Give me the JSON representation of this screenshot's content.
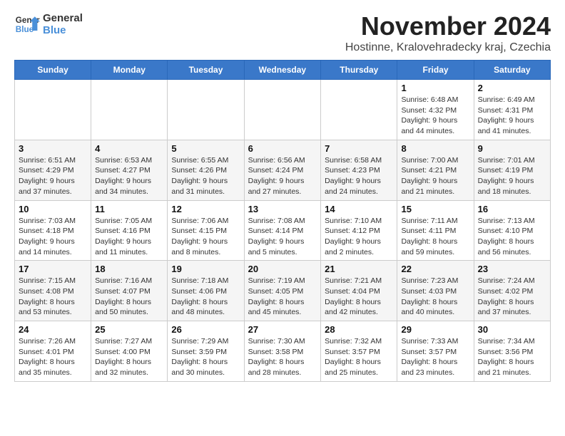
{
  "logo": {
    "line1": "General",
    "line2": "Blue"
  },
  "title": {
    "month": "November 2024",
    "location": "Hostinne, Kralovehradecky kraj, Czechia"
  },
  "weekdays": [
    "Sunday",
    "Monday",
    "Tuesday",
    "Wednesday",
    "Thursday",
    "Friday",
    "Saturday"
  ],
  "weeks": [
    [
      {
        "day": "",
        "info": ""
      },
      {
        "day": "",
        "info": ""
      },
      {
        "day": "",
        "info": ""
      },
      {
        "day": "",
        "info": ""
      },
      {
        "day": "",
        "info": ""
      },
      {
        "day": "1",
        "info": "Sunrise: 6:48 AM\nSunset: 4:32 PM\nDaylight: 9 hours and 44 minutes."
      },
      {
        "day": "2",
        "info": "Sunrise: 6:49 AM\nSunset: 4:31 PM\nDaylight: 9 hours and 41 minutes."
      }
    ],
    [
      {
        "day": "3",
        "info": "Sunrise: 6:51 AM\nSunset: 4:29 PM\nDaylight: 9 hours and 37 minutes."
      },
      {
        "day": "4",
        "info": "Sunrise: 6:53 AM\nSunset: 4:27 PM\nDaylight: 9 hours and 34 minutes."
      },
      {
        "day": "5",
        "info": "Sunrise: 6:55 AM\nSunset: 4:26 PM\nDaylight: 9 hours and 31 minutes."
      },
      {
        "day": "6",
        "info": "Sunrise: 6:56 AM\nSunset: 4:24 PM\nDaylight: 9 hours and 27 minutes."
      },
      {
        "day": "7",
        "info": "Sunrise: 6:58 AM\nSunset: 4:23 PM\nDaylight: 9 hours and 24 minutes."
      },
      {
        "day": "8",
        "info": "Sunrise: 7:00 AM\nSunset: 4:21 PM\nDaylight: 9 hours and 21 minutes."
      },
      {
        "day": "9",
        "info": "Sunrise: 7:01 AM\nSunset: 4:19 PM\nDaylight: 9 hours and 18 minutes."
      }
    ],
    [
      {
        "day": "10",
        "info": "Sunrise: 7:03 AM\nSunset: 4:18 PM\nDaylight: 9 hours and 14 minutes."
      },
      {
        "day": "11",
        "info": "Sunrise: 7:05 AM\nSunset: 4:16 PM\nDaylight: 9 hours and 11 minutes."
      },
      {
        "day": "12",
        "info": "Sunrise: 7:06 AM\nSunset: 4:15 PM\nDaylight: 9 hours and 8 minutes."
      },
      {
        "day": "13",
        "info": "Sunrise: 7:08 AM\nSunset: 4:14 PM\nDaylight: 9 hours and 5 minutes."
      },
      {
        "day": "14",
        "info": "Sunrise: 7:10 AM\nSunset: 4:12 PM\nDaylight: 9 hours and 2 minutes."
      },
      {
        "day": "15",
        "info": "Sunrise: 7:11 AM\nSunset: 4:11 PM\nDaylight: 8 hours and 59 minutes."
      },
      {
        "day": "16",
        "info": "Sunrise: 7:13 AM\nSunset: 4:10 PM\nDaylight: 8 hours and 56 minutes."
      }
    ],
    [
      {
        "day": "17",
        "info": "Sunrise: 7:15 AM\nSunset: 4:08 PM\nDaylight: 8 hours and 53 minutes."
      },
      {
        "day": "18",
        "info": "Sunrise: 7:16 AM\nSunset: 4:07 PM\nDaylight: 8 hours and 50 minutes."
      },
      {
        "day": "19",
        "info": "Sunrise: 7:18 AM\nSunset: 4:06 PM\nDaylight: 8 hours and 48 minutes."
      },
      {
        "day": "20",
        "info": "Sunrise: 7:19 AM\nSunset: 4:05 PM\nDaylight: 8 hours and 45 minutes."
      },
      {
        "day": "21",
        "info": "Sunrise: 7:21 AM\nSunset: 4:04 PM\nDaylight: 8 hours and 42 minutes."
      },
      {
        "day": "22",
        "info": "Sunrise: 7:23 AM\nSunset: 4:03 PM\nDaylight: 8 hours and 40 minutes."
      },
      {
        "day": "23",
        "info": "Sunrise: 7:24 AM\nSunset: 4:02 PM\nDaylight: 8 hours and 37 minutes."
      }
    ],
    [
      {
        "day": "24",
        "info": "Sunrise: 7:26 AM\nSunset: 4:01 PM\nDaylight: 8 hours and 35 minutes."
      },
      {
        "day": "25",
        "info": "Sunrise: 7:27 AM\nSunset: 4:00 PM\nDaylight: 8 hours and 32 minutes."
      },
      {
        "day": "26",
        "info": "Sunrise: 7:29 AM\nSunset: 3:59 PM\nDaylight: 8 hours and 30 minutes."
      },
      {
        "day": "27",
        "info": "Sunrise: 7:30 AM\nSunset: 3:58 PM\nDaylight: 8 hours and 28 minutes."
      },
      {
        "day": "28",
        "info": "Sunrise: 7:32 AM\nSunset: 3:57 PM\nDaylight: 8 hours and 25 minutes."
      },
      {
        "day": "29",
        "info": "Sunrise: 7:33 AM\nSunset: 3:57 PM\nDaylight: 8 hours and 23 minutes."
      },
      {
        "day": "30",
        "info": "Sunrise: 7:34 AM\nSunset: 3:56 PM\nDaylight: 8 hours and 21 minutes."
      }
    ]
  ]
}
